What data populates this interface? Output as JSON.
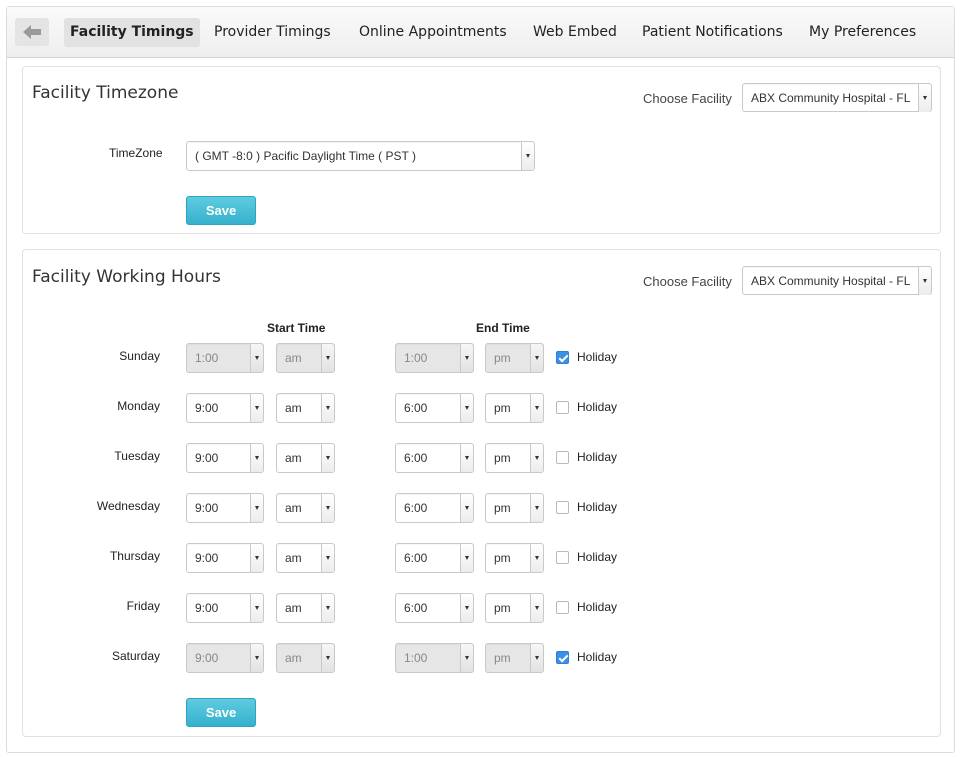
{
  "tabs": [
    {
      "label": "Facility Timings",
      "active": true
    },
    {
      "label": "Provider Timings",
      "active": false
    },
    {
      "label": "Online Appointments",
      "active": false
    },
    {
      "label": "Web Embed",
      "active": false
    },
    {
      "label": "Patient Notifications",
      "active": false
    },
    {
      "label": "My Preferences",
      "active": false
    }
  ],
  "timezone_panel": {
    "title": "Facility Timezone",
    "choose_facility_label": "Choose Facility",
    "facility_value": "ABX Community Hospital - FL",
    "timezone_label": "TimeZone",
    "timezone_value": "( GMT -8:0 ) Pacific Daylight Time ( PST )",
    "save_label": "Save"
  },
  "hours_panel": {
    "title": "Facility Working Hours",
    "choose_facility_label": "Choose Facility",
    "facility_value": "ABX Community Hospital - FL",
    "start_time_label": "Start Time",
    "end_time_label": "End Time",
    "holiday_label": "Holiday",
    "save_label": "Save",
    "days": [
      {
        "day": "Sunday",
        "start": "1:00",
        "start_ampm": "am",
        "end": "1:00",
        "end_ampm": "pm",
        "holiday": true
      },
      {
        "day": "Monday",
        "start": "9:00",
        "start_ampm": "am",
        "end": "6:00",
        "end_ampm": "pm",
        "holiday": false
      },
      {
        "day": "Tuesday",
        "start": "9:00",
        "start_ampm": "am",
        "end": "6:00",
        "end_ampm": "pm",
        "holiday": false
      },
      {
        "day": "Wednesday",
        "start": "9:00",
        "start_ampm": "am",
        "end": "6:00",
        "end_ampm": "pm",
        "holiday": false
      },
      {
        "day": "Thursday",
        "start": "9:00",
        "start_ampm": "am",
        "end": "6:00",
        "end_ampm": "pm",
        "holiday": false
      },
      {
        "day": "Friday",
        "start": "9:00",
        "start_ampm": "am",
        "end": "6:00",
        "end_ampm": "pm",
        "holiday": false
      },
      {
        "day": "Saturday",
        "start": "9:00",
        "start_ampm": "am",
        "end": "1:00",
        "end_ampm": "pm",
        "holiday": true
      }
    ]
  },
  "colors": {
    "accent": "#3fb6cf",
    "checkbox_checked": "#3d8fe6",
    "disabled_field": "#e6e6e6"
  },
  "icons": {
    "back": "back-arrow-icon"
  }
}
